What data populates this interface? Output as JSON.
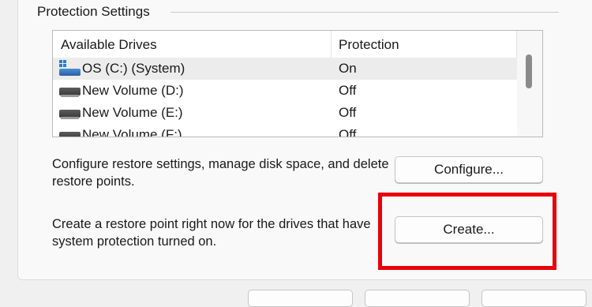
{
  "group": {
    "title": "Protection Settings"
  },
  "drives_table": {
    "headers": {
      "drive": "Available Drives",
      "protection": "Protection"
    },
    "rows": [
      {
        "drive": "OS (C:) (System)",
        "protection": "On",
        "icon": "system-drive-icon",
        "selected": true
      },
      {
        "drive": "New Volume (D:)",
        "protection": "Off",
        "icon": "drive-icon"
      },
      {
        "drive": "New Volume (E:)",
        "protection": "Off",
        "icon": "drive-icon"
      },
      {
        "drive": "New Volume (F:)",
        "protection": "Off",
        "icon": "drive-icon"
      }
    ]
  },
  "configure": {
    "description": "Configure restore settings, manage disk space, and delete restore points.",
    "button_label": "Configure..."
  },
  "create": {
    "description": "Create a restore point right now for the drives that have system protection turned on.",
    "button_label": "Create..."
  },
  "colors": {
    "highlight": "#e8000b",
    "selected_row": "#ececec",
    "os_icon": "#1e7fd6"
  }
}
